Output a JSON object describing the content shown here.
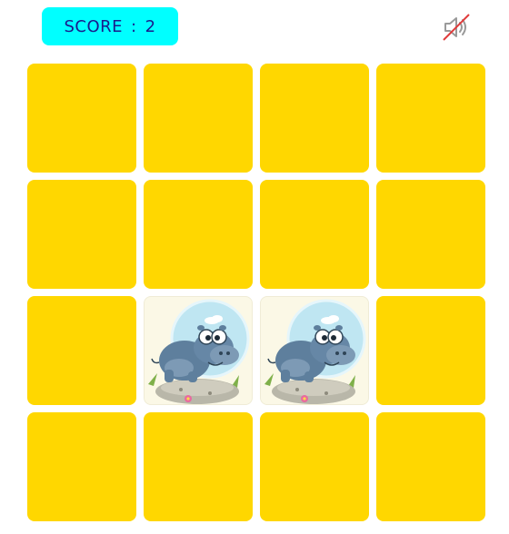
{
  "header": {
    "score_label": "SCORE",
    "score_separator": ":",
    "score_value": "2",
    "sound_icon": "speaker-muted-icon"
  },
  "colors": {
    "card_back": "#ffd700",
    "score_bg": "#00ffff",
    "score_text": "#1a1a8c",
    "mute_slash": "#e03b3b"
  },
  "board": {
    "rows": 4,
    "cols": 4,
    "cards": [
      {
        "state": "hidden"
      },
      {
        "state": "hidden"
      },
      {
        "state": "hidden"
      },
      {
        "state": "hidden"
      },
      {
        "state": "hidden"
      },
      {
        "state": "hidden"
      },
      {
        "state": "hidden"
      },
      {
        "state": "hidden"
      },
      {
        "state": "hidden"
      },
      {
        "state": "revealed",
        "image": "hippo-icon"
      },
      {
        "state": "revealed",
        "image": "hippo-icon"
      },
      {
        "state": "hidden"
      },
      {
        "state": "hidden"
      },
      {
        "state": "hidden"
      },
      {
        "state": "hidden"
      },
      {
        "state": "hidden"
      }
    ]
  }
}
